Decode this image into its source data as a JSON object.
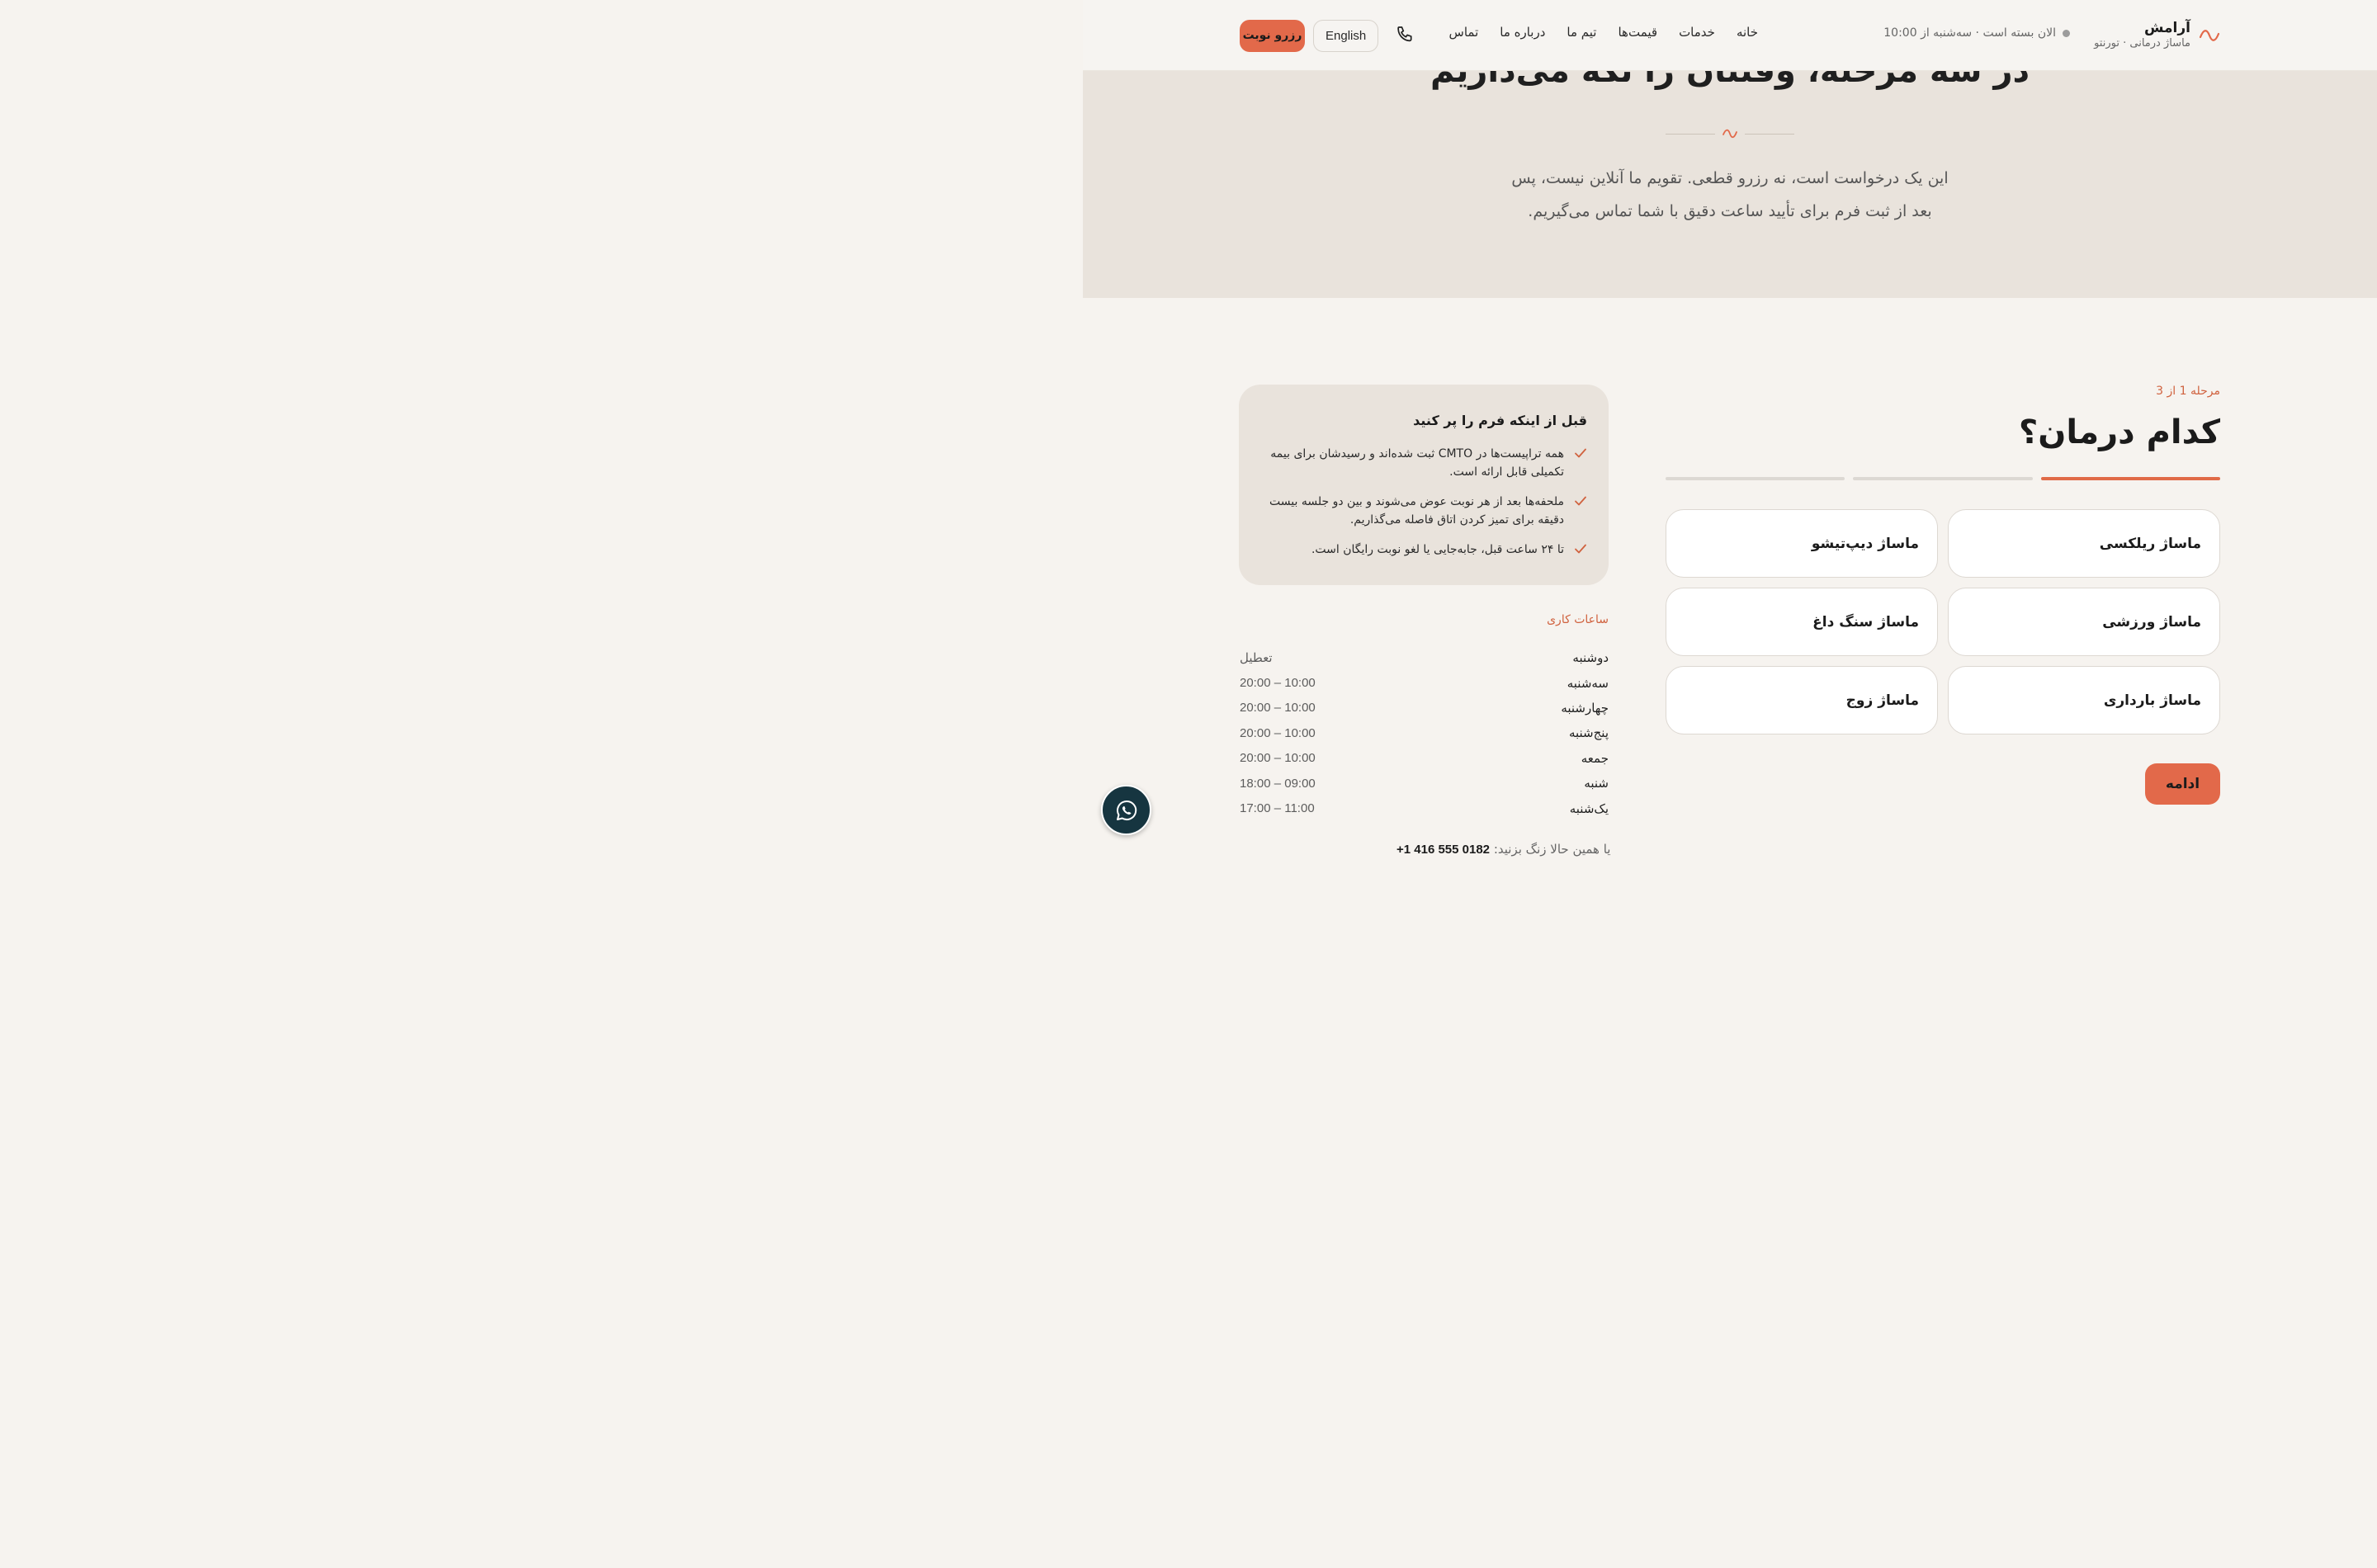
{
  "brand": {
    "name": "آرامش",
    "subtitle": "ماساژ درمانی · تورنتو"
  },
  "status": {
    "text": "الان بسته است · سه‌شنبه از 10:00"
  },
  "nav": {
    "items": [
      "خانه",
      "خدمات",
      "قیمت‌ها",
      "تیم ما",
      "درباره ما",
      "تماس"
    ]
  },
  "header": {
    "lang_label": "English",
    "book_label": "رزرو نوبت"
  },
  "hero": {
    "title": "در سه مرحله، وقتتان را نگه می‌داریم",
    "desc_line1": "این یک درخواست است، نه رزرو قطعی. تقویم ما آنلاین نیست، پس",
    "desc_line2": "بعد از ثبت فرم برای تأیید ساعت دقیق با شما تماس می‌گیریم."
  },
  "form": {
    "step_label": "مرحله 1 از 3",
    "title": "کدام درمان؟",
    "progress_current": 1,
    "progress_total": 3,
    "options": [
      "ماساژ ریلکسی",
      "ماساژ دیپ‌تیشو",
      "ماساژ ورزشی",
      "ماساژ سنگ داغ",
      "ماساژ بارداری",
      "ماساژ زوج"
    ],
    "continue_label": "ادامه"
  },
  "info": {
    "title": "قبل از اینکه فرم را پر کنید",
    "items": [
      "همه تراپیست‌ها در CMTO ثبت شده‌اند و رسیدشان برای بیمه تکمیلی قابل ارائه است.",
      "ملحفه‌ها بعد از هر نوبت عوض می‌شوند و بین دو جلسه بیست دقیقه برای تمیز کردن اتاق فاصله می‌گذاریم.",
      "تا ۲۴ ساعت قبل، جابه‌جایی یا لغو نوبت رایگان است."
    ]
  },
  "hours": {
    "title": "ساعات کاری",
    "rows": [
      {
        "day": "دوشنبه",
        "time": "تعطیل"
      },
      {
        "day": "سه‌شنبه",
        "time": "10:00 – 20:00"
      },
      {
        "day": "چهارشنبه",
        "time": "10:00 – 20:00"
      },
      {
        "day": "پنج‌شنبه",
        "time": "10:00 – 20:00"
      },
      {
        "day": "جمعه",
        "time": "10:00 – 20:00"
      },
      {
        "day": "شنبه",
        "time": "09:00 – 18:00"
      },
      {
        "day": "یک‌شنبه",
        "time": "11:00 – 17:00"
      }
    ]
  },
  "call": {
    "prefix": "یا همین حالا زنگ بزنید:",
    "phone": "+1 416 555 0182"
  },
  "colors": {
    "accent": "#e2694a",
    "hero_bg": "#e9e3dc",
    "page_bg": "#f6f3ef",
    "whatsapp_bg": "#163540"
  },
  "icons": {
    "logo": "wave-icon",
    "phone": "phone-icon",
    "check": "check-icon",
    "whatsapp": "whatsapp-icon"
  }
}
